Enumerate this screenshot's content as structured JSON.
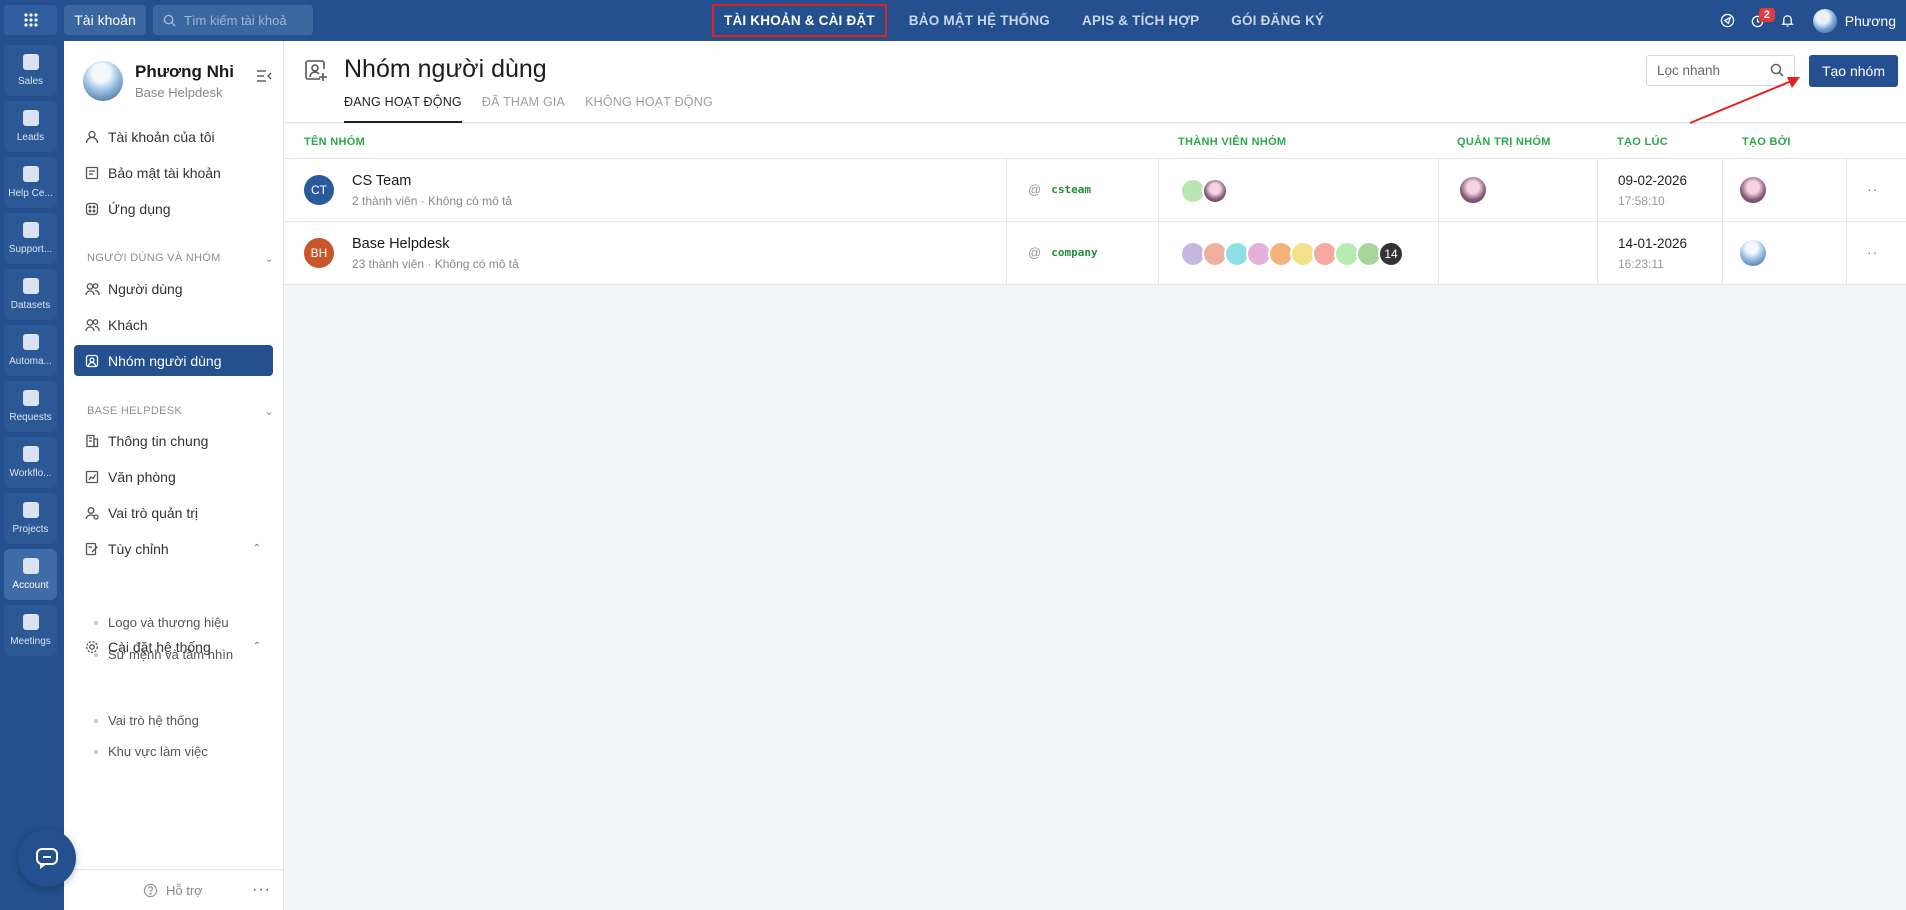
{
  "topbar": {
    "account_label": "Tài khoản",
    "search_placeholder": "Tìm kiếm tài khoả",
    "nav": [
      "TÀI KHOẢN & CÀI ĐẶT",
      "BẢO MẬT HỆ THỐNG",
      "APIS & TÍCH HỢP",
      "GÓI ĐĂNG KÝ"
    ],
    "notification_count": "2",
    "user_name": "Phương"
  },
  "rail": {
    "items": [
      "Sales",
      "Leads",
      "Help Ce...",
      "Support...",
      "Datasets",
      "Automa...",
      "Requests",
      "Workflo...",
      "Projects",
      "Account",
      "Meetings"
    ]
  },
  "sidebar": {
    "profile_name": "Phương Nhi",
    "profile_sub": "Base Helpdesk",
    "items_top": [
      "Tài khoản của tôi",
      "Bảo mật tài khoản",
      "Ứng dụng"
    ],
    "section_users": "NGƯỜI DÙNG VÀ NHÓM",
    "items_users": [
      "Người dùng",
      "Khách",
      "Nhóm người dùng"
    ],
    "section_base": "BASE HELPDESK",
    "items_base": [
      "Thông tin chung",
      "Văn phòng",
      "Vai trò quản trị",
      "Tùy chỉnh"
    ],
    "sub_custom": [
      "Logo và thương hiệu",
      "Sứ mệnh và tầm nhìn"
    ],
    "system_settings": "Cài đặt hệ thống",
    "sub_system": [
      "Vai trò hệ thống",
      "Khu vực làm việc"
    ],
    "footer_label": "Hỗ trợ"
  },
  "main": {
    "title": "Nhóm người dùng",
    "tabs": [
      "ĐANG HOẠT ĐỘNG",
      "ĐÃ THAM GIA",
      "KHÔNG HOẠT ĐỘNG"
    ],
    "quick_search_placeholder": "Lọc nhanh",
    "create_button": "Tạo nhóm",
    "columns": [
      "TÊN NHÓM",
      "THÀNH VIÊN NHÓM",
      "QUẢN TRỊ NHÓM",
      "TẠO LÚC",
      "TẠO BỞI"
    ],
    "rows": [
      {
        "initials": "CT",
        "badge_color": "#2a5a9c",
        "name": "CS Team",
        "sub": "2 thành viên · Không có mô tả",
        "handle": "csteam",
        "date": "09-02-2026",
        "time": "17:58:10"
      },
      {
        "initials": "BH",
        "badge_color": "#c9552b",
        "name": "Base Helpdesk",
        "sub": "23 thành viên · Không có mô tả",
        "handle": "company",
        "date": "14-01-2026",
        "time": "16:23:11",
        "more_members": "14"
      }
    ]
  },
  "colors": {
    "brand": "#24508f",
    "header_green": "#2ba84a",
    "highlight_red": "#e02222"
  }
}
